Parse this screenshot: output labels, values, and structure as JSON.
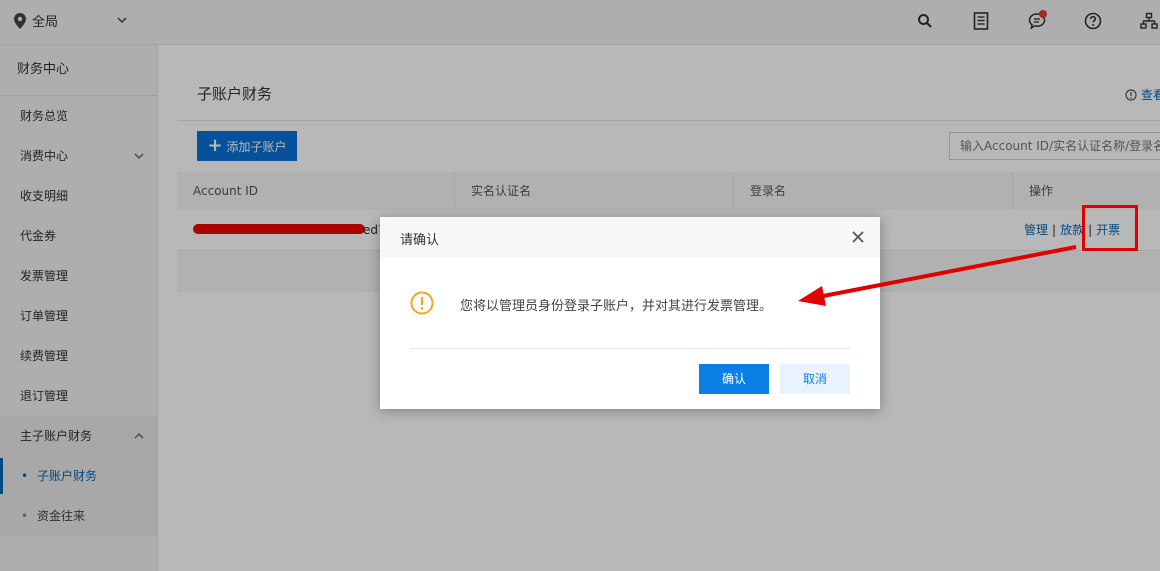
{
  "topbar": {
    "region_label": "全局",
    "icons": [
      "search-icon",
      "document-icon",
      "message-icon",
      "help-icon",
      "org-icon"
    ]
  },
  "sidebar": {
    "title": "财务中心",
    "items": [
      {
        "label": "财务总览"
      },
      {
        "label": "消费中心"
      },
      {
        "label": "收支明细"
      },
      {
        "label": "代金券"
      },
      {
        "label": "发票管理"
      },
      {
        "label": "订单管理"
      },
      {
        "label": "续费管理"
      },
      {
        "label": "退订管理"
      },
      {
        "label": "主子账户财务"
      }
    ],
    "subitems": [
      {
        "label": "子账户财务",
        "active": true
      },
      {
        "label": "资金往来",
        "active": false
      }
    ]
  },
  "main": {
    "title": "子账户财务",
    "help_link": "查看",
    "add_button": "添加子账户",
    "search_placeholder": "输入Account ID/实名认证名称/登录名",
    "columns": [
      "Account ID",
      "实名认证名",
      "登录名",
      "操作"
    ],
    "row": {
      "account_id_suffix": "ed7",
      "op_manage": "管理",
      "op_disburse": "放款",
      "op_invoice": "开票"
    }
  },
  "dialog": {
    "title": "请确认",
    "message": "您将以管理员身份登录子账户，并对其进行发票管理。",
    "confirm": "确认",
    "cancel": "取消"
  },
  "colors": {
    "primary": "#0a6fd6",
    "link": "#0067b8",
    "annotation": "#e00000",
    "warning": "#f5a623"
  }
}
